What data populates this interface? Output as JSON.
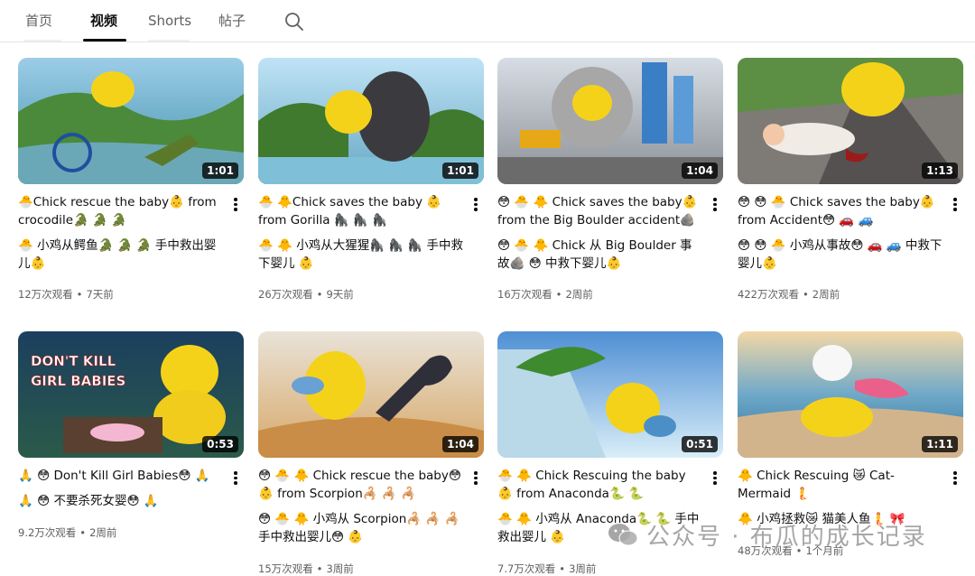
{
  "tabs": [
    {
      "label": "首页"
    },
    {
      "label": "视频"
    },
    {
      "label": "Shorts"
    },
    {
      "label": "帖子"
    }
  ],
  "search_icon": "search-icon",
  "videos": [
    {
      "title": "🐣Chick rescue the baby👶 from crocodile🐊 🐊 🐊",
      "subtitle": "🐣 小鸡从鳄鱼🐊 🐊 🐊 手中救出婴儿👶",
      "views": "12万次观看",
      "age": "7天前",
      "duration": "1:01"
    },
    {
      "title": "🐣 🐥Chick saves the baby 👶 from Gorilla 🦍 🦍 🦍",
      "subtitle": "🐣 🐥 小鸡从大猩猩🦍 🦍 🦍 手中救下婴儿 👶",
      "views": "26万次观看",
      "age": "9天前",
      "duration": "1:01"
    },
    {
      "title": "😳 🐣 🐥 Chick saves the baby👶 from the Big Boulder accident🪨 😳",
      "subtitle": "😳 🐣 🐥 Chick 从 Big Boulder 事故🪨 😳 中救下婴儿👶",
      "views": "16万次观看",
      "age": "2周前",
      "duration": "1:04"
    },
    {
      "title": "😳 😳 🐣 Chick saves the baby👶 from Accident😳 🚗 🚙",
      "subtitle": "😳 😳 🐣 小鸡从事故😳 🚗 🚙 中救下婴儿👶",
      "views": "422万次观看",
      "age": "2周前",
      "duration": "1:13"
    },
    {
      "title": "🙏 😳 Don't Kill Girl Babies😳 🙏",
      "subtitle": "🙏 😳 不要杀死女婴😳 🙏",
      "views": "9.2万次观看",
      "age": "2周前",
      "duration": "0:53"
    },
    {
      "title": "😳 🐣 🐥 Chick rescue the baby😳 👶 from Scorpion🦂 🦂 🦂",
      "subtitle": "😳 🐣 🐥 小鸡从 Scorpion🦂 🦂 🦂 手中救出婴儿😳 👶",
      "views": "15万次观看",
      "age": "3周前",
      "duration": "1:04"
    },
    {
      "title": "🐣 🐥 Chick Rescuing the baby 👶 from Anaconda🐍 🐍",
      "subtitle": "🐣 🐥 小鸡从 Anaconda🐍 🐍 手中救出婴儿 👶",
      "views": "7.7万次观看",
      "age": "3周前",
      "duration": "0:51"
    },
    {
      "title": "🐥 Chick Rescuing 😿 Cat-Mermaid 🧜",
      "subtitle": "🐥 小鸡拯救😿 猫美人鱼🧜 🎀",
      "views": "48万次观看",
      "age": "1个月前",
      "duration": "1:11"
    }
  ],
  "watermark": {
    "text": "公众号 · 布瓜的成长记录",
    "icon": "wechat-icon"
  }
}
